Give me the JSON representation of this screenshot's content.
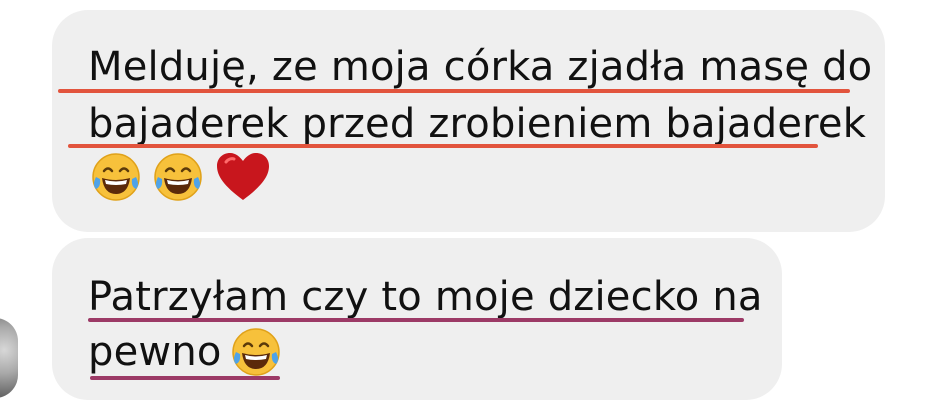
{
  "messages": [
    {
      "lines": [
        "Melduję, ze moja córka zjadła masę do",
        "bajaderek przed zrobieniem bajaderek"
      ],
      "emojis": [
        "face-with-tears-of-joy-icon",
        "face-with-tears-of-joy-icon",
        "red-heart-icon"
      ],
      "underline_color": "#e2543d"
    },
    {
      "lines": [
        "Patrzyłam czy to moje dziecko na",
        "pewno"
      ],
      "emojis": [
        "face-with-tears-of-joy-icon"
      ],
      "underline_color": "#9c3a66"
    }
  ],
  "colors": {
    "bubble_background": "#efefef",
    "text": "#111111"
  }
}
